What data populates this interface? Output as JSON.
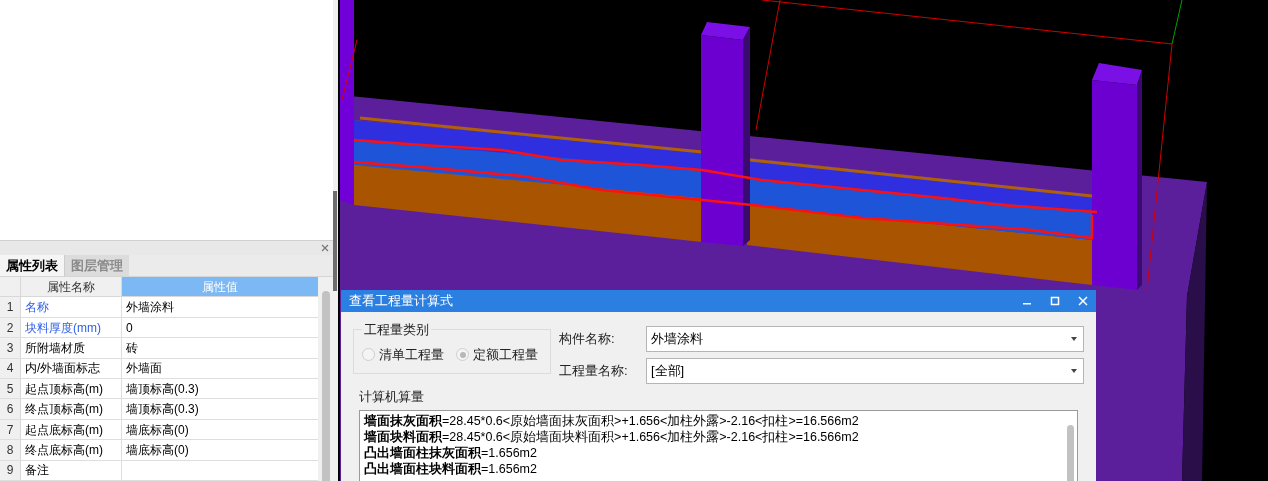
{
  "properties_panel": {
    "tabs": [
      {
        "label": "属性列表",
        "selected": true
      },
      {
        "label": "图层管理",
        "selected": false
      }
    ],
    "columns": [
      "属性名称",
      "属性值"
    ],
    "rows": [
      {
        "index": "1",
        "name": "名称",
        "value": "外墙涂料",
        "highlighted": true
      },
      {
        "index": "2",
        "name": "块料厚度(mm)",
        "value": "0",
        "highlighted": true
      },
      {
        "index": "3",
        "name": "所附墙材质",
        "value": "砖",
        "highlighted": false
      },
      {
        "index": "4",
        "name": "内/外墙面标志",
        "value": "外墙面",
        "highlighted": false
      },
      {
        "index": "5",
        "name": "起点顶标高(m)",
        "value": "墙顶标高(0.3)",
        "highlighted": false
      },
      {
        "index": "6",
        "name": "终点顶标高(m)",
        "value": "墙顶标高(0.3)",
        "highlighted": false
      },
      {
        "index": "7",
        "name": "起点底标高(m)",
        "value": "墙底标高(0)",
        "highlighted": false
      },
      {
        "index": "8",
        "name": "终点底标高(m)",
        "value": "墙底标高(0)",
        "highlighted": false
      },
      {
        "index": "9",
        "name": "备注",
        "value": "",
        "highlighted": false
      }
    ]
  },
  "dialog": {
    "title": "查看工程量计算式",
    "category": {
      "legend": "工程量类别",
      "options": [
        {
          "label": "清单工程量",
          "selected": false
        },
        {
          "label": "定额工程量",
          "selected": true
        }
      ]
    },
    "fields": [
      {
        "label": "构件名称:",
        "value": "外墙涂料"
      },
      {
        "label": "工程量名称:",
        "value": "[全部]"
      }
    ],
    "output": {
      "legend": "计算机算量",
      "lines": [
        "**墙面抹灰面积**=28.45*0.6<原始墙面抹灰面积>+1.656<加柱外露>-2.16<扣柱>=16.566m2",
        "**墙面块料面积**=28.45*0.6<原始墙面块料面积>+1.656<加柱外露>-2.16<扣柱>=16.566m2",
        "**凸出墙面柱抹灰面积**=1.656m2",
        "**凸出墙面柱块料面积**=1.656m2"
      ]
    }
  }
}
